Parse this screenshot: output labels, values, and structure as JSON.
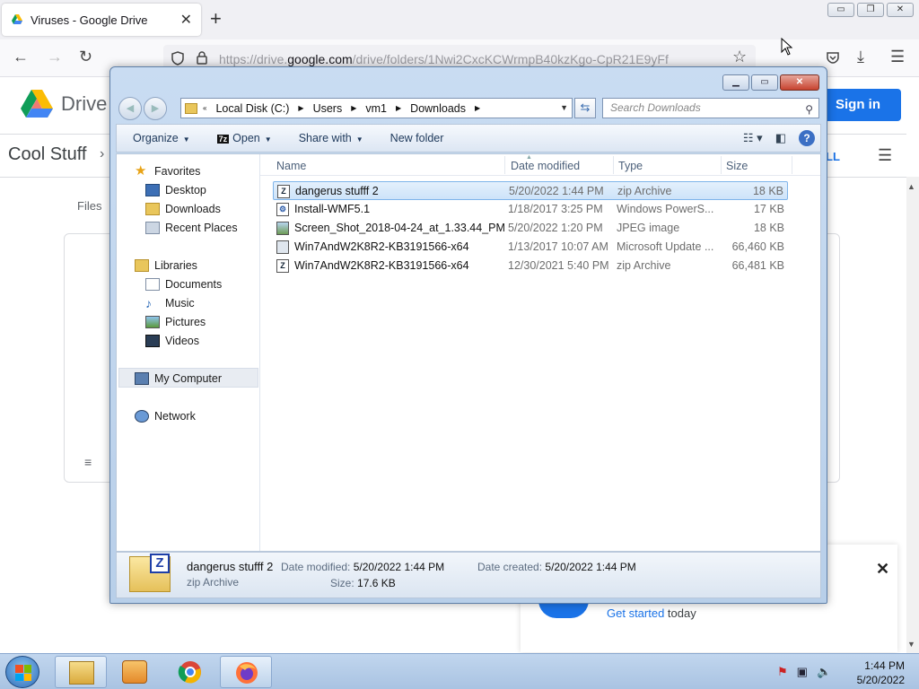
{
  "browser": {
    "tab_title": "Viruses - Google Drive",
    "tab_close": "✕",
    "new_tab": "+",
    "url_prefix": "https://drive.",
    "url_domain": "google.com",
    "url_rest": "/drive/folders/1Nwi2CxcKCWrmpB40kzKgo-CpR21E9yFf",
    "window_buttons": [
      "▭",
      "❐",
      "✕"
    ]
  },
  "drive": {
    "logo_text": "Drive",
    "sign_in": "Sign in",
    "folder_name": "Cool Stuff",
    "files_label": "Files",
    "all_link": "LL",
    "promo_text_link": "Get started",
    "promo_text_rest": " today",
    "promo_s": "s"
  },
  "explorer": {
    "breadcrumbs": [
      "Local Disk (C:)",
      "Users",
      "vm1",
      "Downloads"
    ],
    "search_placeholder": "Search Downloads",
    "toolbar": {
      "organize": "Organize",
      "open": "Open",
      "share_with": "Share with",
      "new_folder": "New folder"
    },
    "nav": {
      "favorites": "Favorites",
      "desktop": "Desktop",
      "downloads": "Downloads",
      "recent_places": "Recent Places",
      "libraries": "Libraries",
      "documents": "Documents",
      "music": "Music",
      "pictures": "Pictures",
      "videos": "Videos",
      "my_computer": "My Computer",
      "network": "Network"
    },
    "columns": {
      "name": "Name",
      "date_modified": "Date modified",
      "type": "Type",
      "size": "Size"
    },
    "files": [
      {
        "name": "dangerus stufff 2",
        "date": "5/20/2022 1:44 PM",
        "type": "zip Archive",
        "size": "18 KB",
        "icon": "zip-icon"
      },
      {
        "name": "Install-WMF5.1",
        "date": "1/18/2017 3:25 PM",
        "type": "Windows PowerS...",
        "size": "17 KB",
        "icon": "powershell-icon"
      },
      {
        "name": "Screen_Shot_2018-04-24_at_1.33.44_PM",
        "date": "5/20/2022 1:20 PM",
        "type": "JPEG image",
        "size": "18 KB",
        "icon": "image-icon"
      },
      {
        "name": "Win7AndW2K8R2-KB3191566-x64",
        "date": "1/13/2017 10:07 AM",
        "type": "Microsoft Update ...",
        "size": "66,460 KB",
        "icon": "update-icon"
      },
      {
        "name": "Win7AndW2K8R2-KB3191566-x64",
        "date": "12/30/2021 5:40 PM",
        "type": "zip Archive",
        "size": "66,481 KB",
        "icon": "zip-icon"
      }
    ],
    "details": {
      "name": "dangerus stufff 2",
      "type": "zip Archive",
      "date_modified_label": "Date modified:",
      "date_modified": "5/20/2022 1:44 PM",
      "date_created_label": "Date created:",
      "date_created": "5/20/2022 1:44 PM",
      "size_label": "Size:",
      "size": "17.6 KB"
    }
  },
  "taskbar": {
    "time": "1:44 PM",
    "date": "5/20/2022"
  }
}
